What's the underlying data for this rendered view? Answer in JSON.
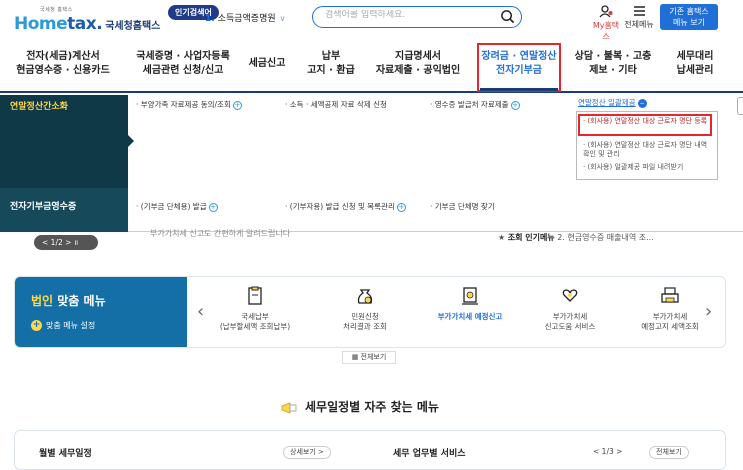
{
  "header": {
    "logo_small": "국세청 홈택스",
    "logo_brand_a": "Home",
    "logo_brand_b": "tax.",
    "logo_suffix": "국세청홈택스",
    "popular_tag": "인기검색어",
    "popular_rank": "1.",
    "popular_term": "소득금액증명원",
    "search_placeholder": "검색어를 입력하세요.",
    "my_label": "My홈택스",
    "menu_label": "전체메뉴",
    "old_btn_line1": "기존 홈택스",
    "old_btn_line2": "메뉴 보기"
  },
  "nav": {
    "items": [
      {
        "l1": "전자(세금)계산서",
        "l2": "현금영수증 · 신용카드"
      },
      {
        "l1": "국세증명 · 사업자등록",
        "l2": "세금관련 신청/신고"
      },
      {
        "l1": "세금신고",
        "l2": ""
      },
      {
        "l1": "납부",
        "l2": "고지 · 환급"
      },
      {
        "l1": "지급명세서",
        "l2": "자료제출 · 공익법인"
      },
      {
        "l1": "장려금 · 연말정산",
        "l2": "전자기부금"
      },
      {
        "l1": "상담 · 불복 · 고충",
        "l2": "제보 · 기타"
      },
      {
        "l1": "세무대리",
        "l2": "납세관리"
      }
    ]
  },
  "dropdown": {
    "section1": "연말정산간소화",
    "section2": "전자기부금영수증",
    "links1": [
      "· 부양가족 자료제공 동의/조회",
      "· 소득 · 세액공제 자료 삭제 신청",
      "· 영수증 발급처 자료제출"
    ],
    "highlight": "연말정산 일괄제공",
    "sub_items": [
      "· (회사용) 연말정산 대상 근로자 명단 등록",
      "· (회사용) 연말정산 대상 근로자 명단 내역 확인 및 관리",
      "· (회사용) 일괄제공 파일 내려받기"
    ],
    "links2": [
      "· (기부금 단체용) 발급",
      "· (기부자용) 발급 신청 및 목록관리",
      "· 기부금 단체명 찾기"
    ]
  },
  "behind": {
    "pager": "< 1/2 >  ॥",
    "partial_text": "부가가치세 신고도 간편하게 알려드립니다",
    "right_prefix": "조회 인기메뉴",
    "right_text": "2. 현금영수증 매출내역 조..."
  },
  "corp_menu": {
    "title_a": "법인",
    "title_b": " 맞춤 메뉴",
    "setting": "맞춤 메뉴 설정",
    "items": [
      {
        "l1": "국세납부",
        "l2": "(납부할세액 조회납부)",
        "blue": false
      },
      {
        "l1": "민원신청",
        "l2": "처리결과 조회",
        "blue": false
      },
      {
        "l1": "부가가치세 예정신고",
        "l2": "",
        "blue": true
      },
      {
        "l1": "부가가치세",
        "l2": "신고도움 서비스",
        "blue": false
      },
      {
        "l1": "부가가치세",
        "l2": "예정고지 세액조회",
        "blue": false
      }
    ],
    "all_view": "전체보기"
  },
  "schedule": {
    "title": "세무일정별 자주 찾는 메뉴",
    "monthly": "월별 세무일정",
    "detail": "상세보기 >",
    "service": "세무 업무별 서비스",
    "page": "< 1/3 >",
    "all": "전체보기"
  },
  "colors": {
    "brand": "#1b5dac",
    "accent": "#1f6fd6",
    "highlight_red": "#e0282e",
    "sidebar": "#0f3946",
    "corp_blue": "#136fa6"
  }
}
